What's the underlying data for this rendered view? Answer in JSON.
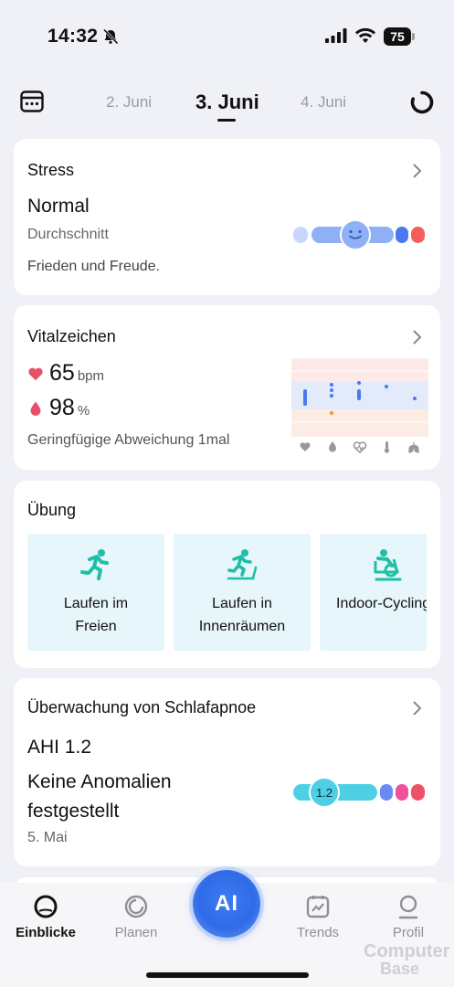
{
  "status_bar": {
    "time": "14:32",
    "battery": "75"
  },
  "date_nav": {
    "prev": "2. Juni",
    "current": "3. Juni",
    "next": "4. Juni"
  },
  "stress": {
    "title": "Stress",
    "level": "Normal",
    "subtitle": "Durchschnitt",
    "description": "Frieden und Freude."
  },
  "vitals": {
    "title": "Vitalzeichen",
    "heart_rate": "65",
    "heart_rate_unit": "bpm",
    "spo2": "98",
    "spo2_unit": "%",
    "note": "Geringfügige Abweichung 1mal",
    "chart_icons": [
      "heart-icon",
      "drop-icon",
      "ecg-heart-icon",
      "thermometer-icon",
      "lungs-icon"
    ]
  },
  "exercise": {
    "title": "Übung",
    "items": [
      {
        "label": "Laufen im\nFreien",
        "icon": "running-outdoor-icon"
      },
      {
        "label": "Laufen in\nInnenräumen",
        "icon": "treadmill-icon"
      },
      {
        "label": "Indoor-Cycling",
        "icon": "indoor-cycling-icon"
      }
    ]
  },
  "apnea": {
    "title": "Überwachung von Schlafapnoe",
    "ahi": "AHI 1.2",
    "status": "Keine Anomalien festgestellt",
    "date": "5. Mai",
    "marker": "1.2"
  },
  "tabbar": {
    "tabs": [
      {
        "label": "Einblicke",
        "icon": "insights-icon",
        "active": true
      },
      {
        "label": "Planen",
        "icon": "plan-icon",
        "active": false
      },
      {
        "label": "Trends",
        "icon": "trends-icon",
        "active": false
      },
      {
        "label": "Profil",
        "icon": "profile-icon",
        "active": false
      }
    ],
    "ai_label": "AI"
  },
  "watermark": {
    "line1": "Computer",
    "line2": "Base"
  },
  "colors": {
    "accent_blue": "#2f6ae8",
    "stress_blue": "#8fb0f5",
    "heart_red": "#e8506a",
    "exercise_teal": "#1fbfa6",
    "apnea_cyan": "#4dcfe6",
    "apnea_pink": "#f0509c"
  }
}
